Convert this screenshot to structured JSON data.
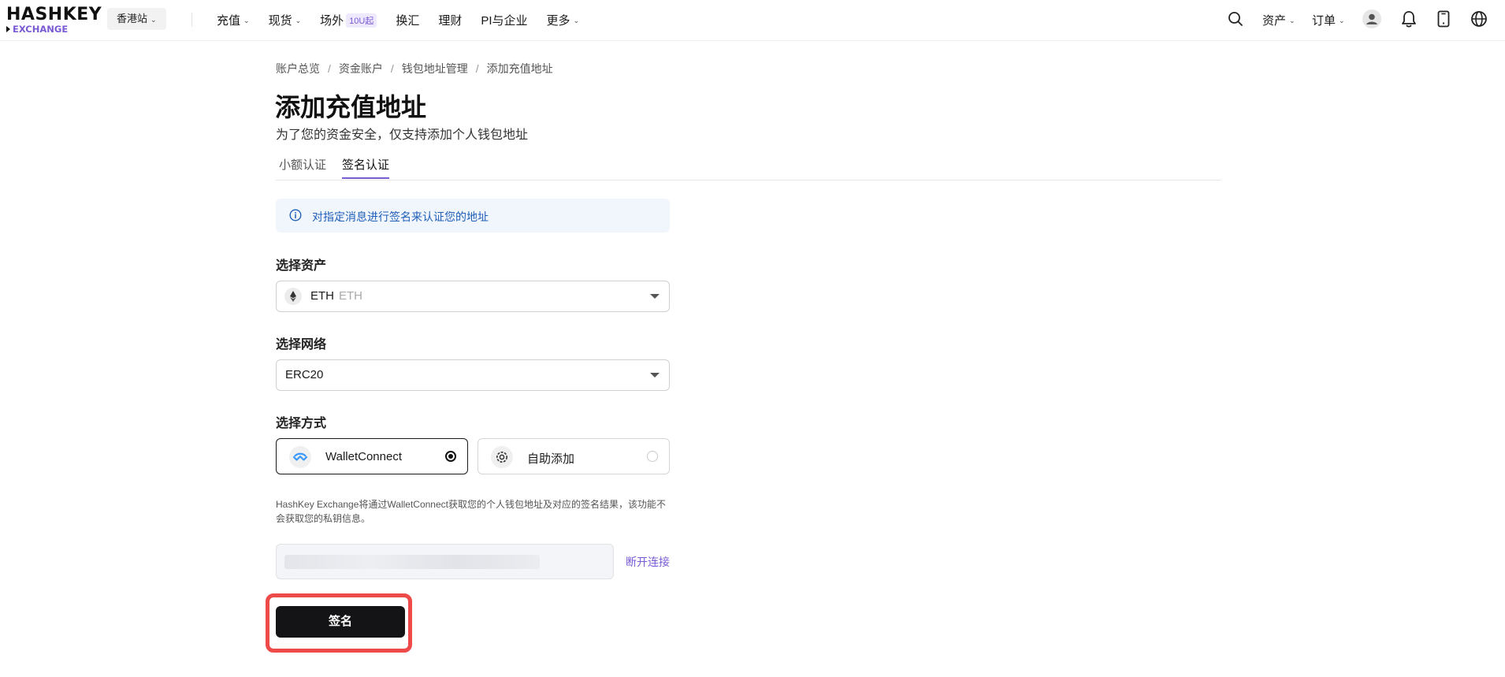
{
  "header": {
    "logo": {
      "main": "HASHKEY",
      "sub": "EXCHANGE"
    },
    "region": "香港站",
    "nav": [
      {
        "label": "充值",
        "dropdown": true
      },
      {
        "label": "现货",
        "dropdown": true
      },
      {
        "label": "场外",
        "badge": "10U起"
      },
      {
        "label": "换汇"
      },
      {
        "label": "理财"
      },
      {
        "label": "PI与企业"
      },
      {
        "label": "更多",
        "dropdown": true
      }
    ],
    "right": {
      "assets": "资产",
      "orders": "订单"
    }
  },
  "breadcrumb": [
    "账户总览",
    "资金账户",
    "钱包地址管理",
    "添加充值地址"
  ],
  "page": {
    "title": "添加充值地址",
    "subtitle": "为了您的资金安全，仅支持添加个人钱包地址"
  },
  "tabs": [
    {
      "label": "小额认证",
      "active": false
    },
    {
      "label": "签名认证",
      "active": true
    }
  ],
  "info": "对指定消息进行签名来认证您的地址",
  "asset": {
    "label": "选择资产",
    "value": "ETH",
    "sub": "ETH"
  },
  "network": {
    "label": "选择网络",
    "value": "ERC20"
  },
  "method": {
    "label": "选择方式",
    "options": [
      {
        "label": "WalletConnect",
        "selected": true,
        "icon": "walletconnect-icon"
      },
      {
        "label": "自助添加",
        "selected": false,
        "icon": "gear-icon"
      }
    ]
  },
  "note": "HashKey Exchange将通过WalletConnect获取您的个人钱包地址及对应的签名结果，该功能不会获取您的私钥信息。",
  "disconnect": "断开连接",
  "sign_button": "签名",
  "colors": {
    "accent": "#7a5bd6",
    "info_text": "#1f5fb8",
    "primary_button": "#141416",
    "highlight": "#ee4a4a"
  }
}
